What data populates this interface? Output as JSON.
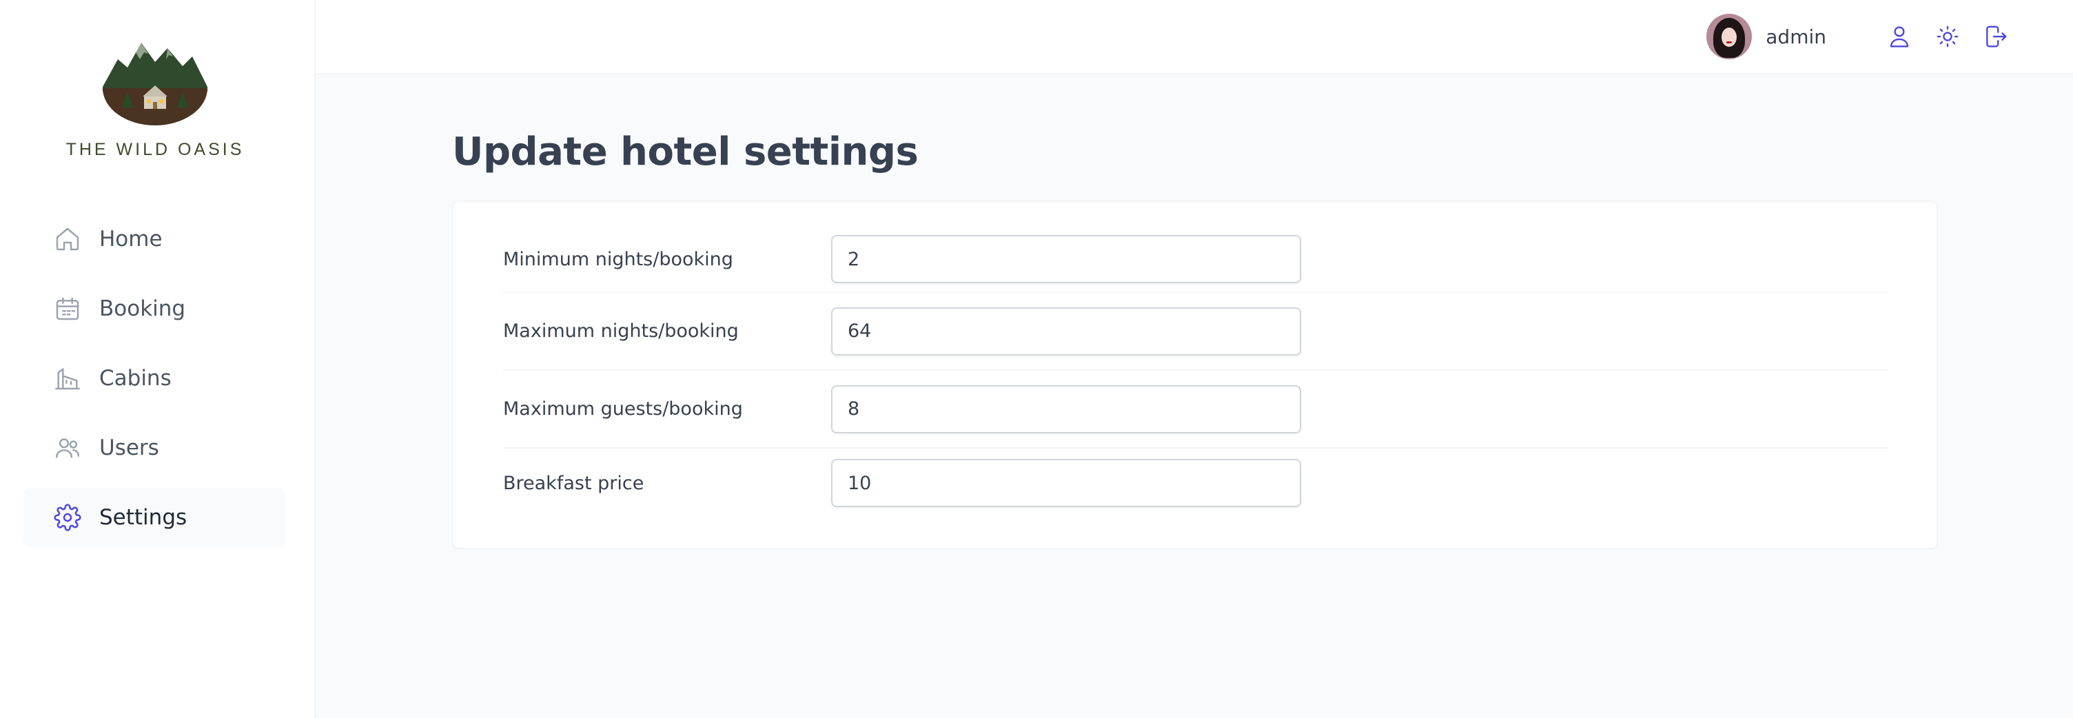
{
  "brand": {
    "name": "THE WILD OASIS"
  },
  "sidebar": {
    "items": [
      {
        "label": "Home",
        "icon": "home-icon"
      },
      {
        "label": "Booking",
        "icon": "calendar-icon"
      },
      {
        "label": "Cabins",
        "icon": "building-icon"
      },
      {
        "label": "Users",
        "icon": "users-icon"
      },
      {
        "label": "Settings",
        "icon": "gear-icon",
        "active": true
      }
    ]
  },
  "header": {
    "username": "admin",
    "icons": [
      "user-icon",
      "sun-icon",
      "logout-icon"
    ]
  },
  "main": {
    "title": "Update hotel settings",
    "fields": [
      {
        "label": "Minimum nights/booking",
        "value": "2"
      },
      {
        "label": "Maximum nights/booking",
        "value": "64"
      },
      {
        "label": "Maximum guests/booking",
        "value": "8"
      },
      {
        "label": "Breakfast price",
        "value": "10"
      }
    ]
  },
  "colors": {
    "accent": "#4f46e5",
    "sidebar_bg": "#ffffff",
    "page_bg": "#f9fafb",
    "text": "#374151"
  }
}
